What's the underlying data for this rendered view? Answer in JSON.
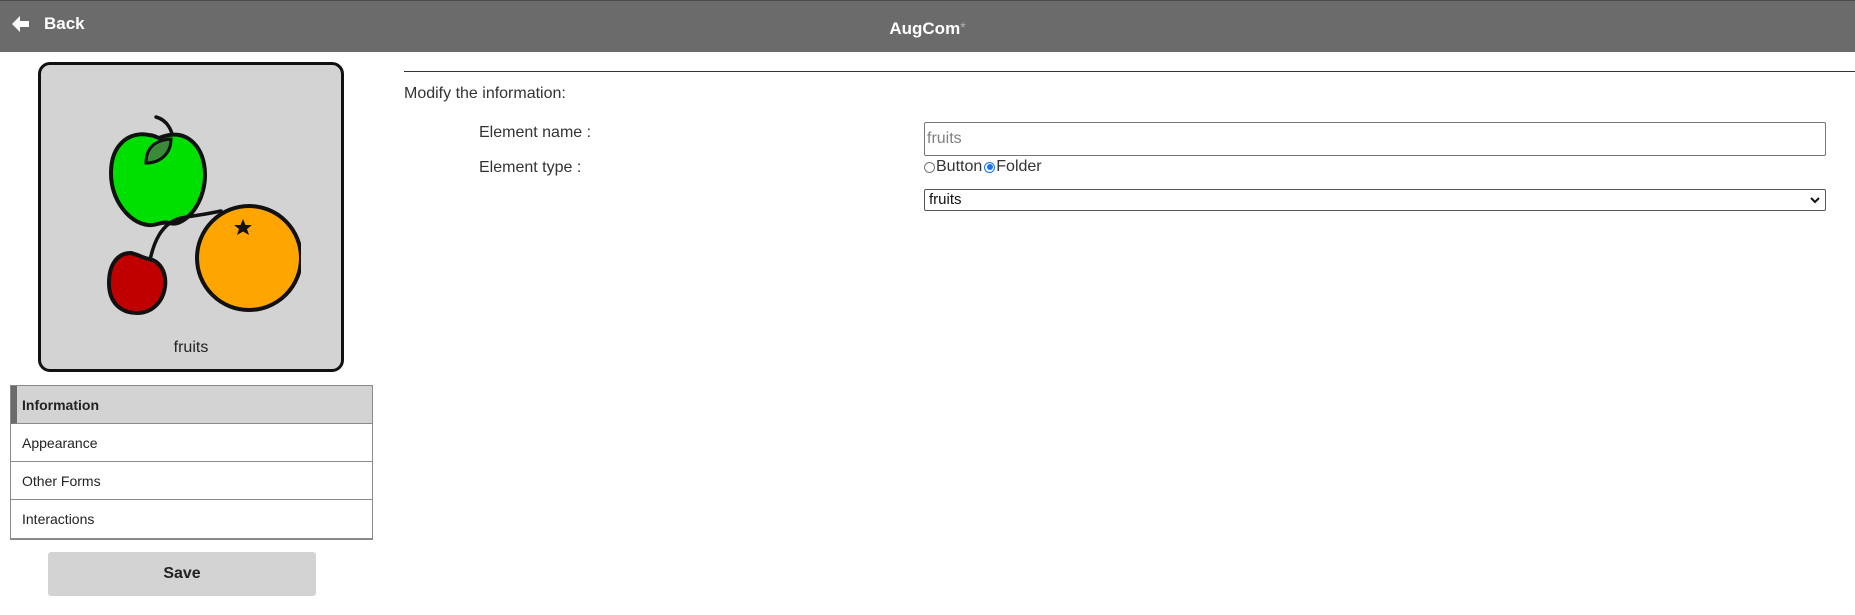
{
  "header": {
    "back_label": "Back",
    "app_title": "AugCom",
    "unsaved_marker": "*"
  },
  "preview": {
    "image_icon": "fruits-pictogram-icon",
    "label": "fruits"
  },
  "tabs": [
    {
      "label": "Information",
      "active": true
    },
    {
      "label": "Appearance",
      "active": false
    },
    {
      "label": "Other Forms",
      "active": false
    },
    {
      "label": "Interactions",
      "active": false
    }
  ],
  "save_label": "Save",
  "form": {
    "heading": "Modify the information:",
    "name_label": "Element name :",
    "name_placeholder": "fruits",
    "type_label": "Element type :",
    "type_options": [
      {
        "label": "Button",
        "checked": false
      },
      {
        "label": "Folder",
        "checked": true
      }
    ],
    "folder_select_value": "fruits"
  },
  "colors": {
    "header_bg": "#6b6b6b",
    "card_bg": "#d3d3d3",
    "radio_accent": "#1a73e8"
  }
}
